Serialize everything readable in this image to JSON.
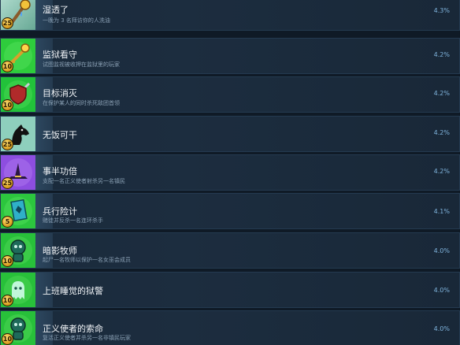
{
  "achievements": [
    {
      "title": "湿透了",
      "description": "一晚为 3 名拜访你的人洗油",
      "percent": "4.3%",
      "points": "25",
      "icon": "dripping-staff-icon",
      "bg": "#86c9b4",
      "fill": 0.043
    },
    {
      "title": "监狱看守",
      "description": "试图监视被收押在监狱里的玩家",
      "percent": "4.2%",
      "points": "10",
      "icon": "jail-key-icon",
      "bg": "#2ecc3c",
      "fill": 0.042
    },
    {
      "title": "目标消灭",
      "description": "在保护某人的同时杀死敌团首领",
      "percent": "4.2%",
      "points": "10",
      "icon": "shield-sword-icon",
      "bg": "#22c23a",
      "fill": 0.042
    },
    {
      "title": "无饭可干",
      "description": "",
      "percent": "4.2%",
      "points": "25",
      "icon": "horse-head-icon",
      "bg": "#8ecfbd",
      "fill": 0.042
    },
    {
      "title": "事半功倍",
      "description": "支配一名正义使者射杀另一名镇民",
      "percent": "4.2%",
      "points": "25",
      "icon": "witch-hat-icon",
      "bg": "#8d4ee0",
      "fill": 0.042
    },
    {
      "title": "兵行险计",
      "description": "赌徒并反杀一名连环杀手",
      "percent": "4.1%",
      "points": "5",
      "icon": "card-icon",
      "bg": "#2cc63e",
      "fill": 0.041
    },
    {
      "title": "暗影牧师",
      "description": "起尸一名牧师以保护一名女巫会成员",
      "percent": "4.0%",
      "points": "10",
      "icon": "zombie-icon",
      "bg": "#28c03a",
      "fill": 0.04
    },
    {
      "title": "上班睡觉的狱警",
      "description": "",
      "percent": "4.0%",
      "points": "10",
      "icon": "ghost-icon",
      "bg": "#28c03a",
      "fill": 0.04
    },
    {
      "title": "正义使者的索命",
      "description": "复活正义使者并杀另一名非镇民玩家",
      "percent": "4.0%",
      "points": "10",
      "icon": "zombie-icon",
      "bg": "#28c03a",
      "fill": 0.04
    }
  ]
}
